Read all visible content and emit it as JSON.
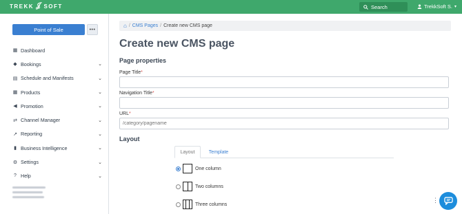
{
  "topbar": {
    "logo_text": "TREKK SOFT",
    "search_label": "Search",
    "user_name": "TrekkSoft S."
  },
  "sidebar": {
    "pos_button": "Point of Sale",
    "more_button": "•••",
    "items": [
      {
        "label": "Dashboard",
        "icon": "dashboard-icon",
        "glyph": "▦",
        "has_chevron": false
      },
      {
        "label": "Bookings",
        "icon": "tag-icon",
        "glyph": "◆",
        "has_chevron": true
      },
      {
        "label": "Schedule and Manifests",
        "icon": "calendar-icon",
        "glyph": "▤",
        "has_chevron": true
      },
      {
        "label": "Products",
        "icon": "grid-icon",
        "glyph": "▦",
        "has_chevron": true
      },
      {
        "label": "Promotion",
        "icon": "megaphone-icon",
        "glyph": "◀",
        "has_chevron": true
      },
      {
        "label": "Channel Manager",
        "icon": "share-icon",
        "glyph": "⇄",
        "has_chevron": true
      },
      {
        "label": "Reporting",
        "icon": "line-chart-icon",
        "glyph": "↗",
        "has_chevron": true
      },
      {
        "label": "Business Intelligence",
        "icon": "bar-chart-icon",
        "glyph": "▮",
        "has_chevron": true
      },
      {
        "label": "Settings",
        "icon": "gear-icon",
        "glyph": "⚙",
        "has_chevron": true
      },
      {
        "label": "Help",
        "icon": "question-icon",
        "glyph": "?",
        "has_chevron": true
      }
    ],
    "chevron": "⌄"
  },
  "breadcrumb": {
    "home_icon": "⌂",
    "cms_pages": "CMS Pages",
    "separator": "/",
    "current": "Create new CMS page"
  },
  "main": {
    "title": "Create new CMS page",
    "page_properties": "Page properties",
    "page_title_label": "Page Title",
    "nav_title_label": "Navigation Title",
    "url_label": "URL",
    "required_mark": "*",
    "page_title_value": "",
    "nav_title_value": "",
    "url_placeholder": "/category/pagename",
    "layout_section": "Layout",
    "tabs": {
      "layout": "Layout",
      "template": "Template"
    },
    "layout_options": [
      {
        "label": "One column",
        "columns": 1,
        "checked": true
      },
      {
        "label": "Two columns",
        "columns": 2,
        "checked": false
      },
      {
        "label": "Three columns",
        "columns": 3,
        "checked": false
      }
    ]
  },
  "colors": {
    "topbar": "#3fa86c",
    "primary": "#3a7fd1",
    "chat": "#1d8ddc"
  }
}
